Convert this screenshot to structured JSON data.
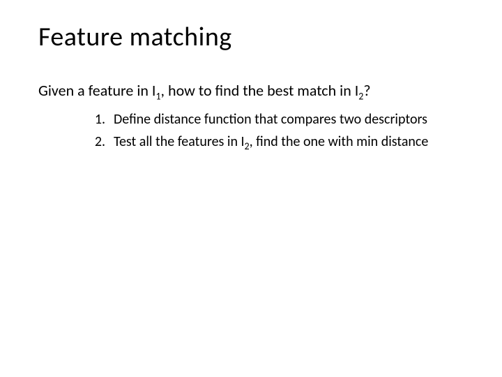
{
  "title": "Feature matching",
  "intro_part1": "Given a feature in I",
  "intro_sub1": "1",
  "intro_part2": ", how to find the best match in I",
  "intro_sub2": "2",
  "intro_part3": "?",
  "items": [
    {
      "num": "1.",
      "text": "Define distance function that compares two descriptors"
    },
    {
      "num": "2.",
      "pre": "Test all the features in I",
      "sub": "2",
      "post": ", find the one with min distance"
    }
  ]
}
